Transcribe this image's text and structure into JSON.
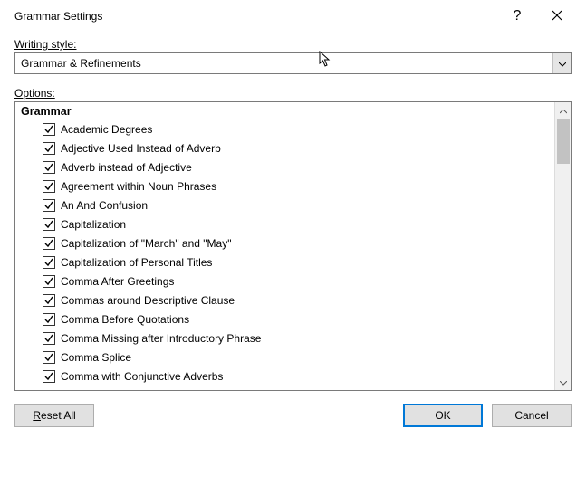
{
  "titlebar": {
    "title": "Grammar Settings",
    "help": "?",
    "close": "✕"
  },
  "writingStyle": {
    "label_pre": "W",
    "label_post": "riting style:",
    "value": "Grammar & Refinements"
  },
  "optionsLabel_pre": "O",
  "optionsLabel_post": "ptions:",
  "group": {
    "header": "Grammar",
    "items": [
      {
        "checked": true,
        "label": "Academic Degrees"
      },
      {
        "checked": true,
        "label": "Adjective Used Instead of Adverb"
      },
      {
        "checked": true,
        "label": "Adverb instead of Adjective"
      },
      {
        "checked": true,
        "label": "Agreement within Noun Phrases"
      },
      {
        "checked": true,
        "label": "An And Confusion"
      },
      {
        "checked": true,
        "label": "Capitalization"
      },
      {
        "checked": true,
        "label": "Capitalization of \"March\" and \"May\""
      },
      {
        "checked": true,
        "label": "Capitalization of Personal Titles"
      },
      {
        "checked": true,
        "label": "Comma After Greetings"
      },
      {
        "checked": true,
        "label": "Commas around Descriptive Clause"
      },
      {
        "checked": true,
        "label": "Comma Before Quotations"
      },
      {
        "checked": true,
        "label": "Comma Missing after Introductory Phrase"
      },
      {
        "checked": true,
        "label": "Comma Splice"
      },
      {
        "checked": true,
        "label": "Comma with Conjunctive Adverbs"
      }
    ]
  },
  "buttons": {
    "resetAll_pre": "R",
    "resetAll_post": "eset All",
    "ok": "OK",
    "cancel": "Cancel"
  }
}
